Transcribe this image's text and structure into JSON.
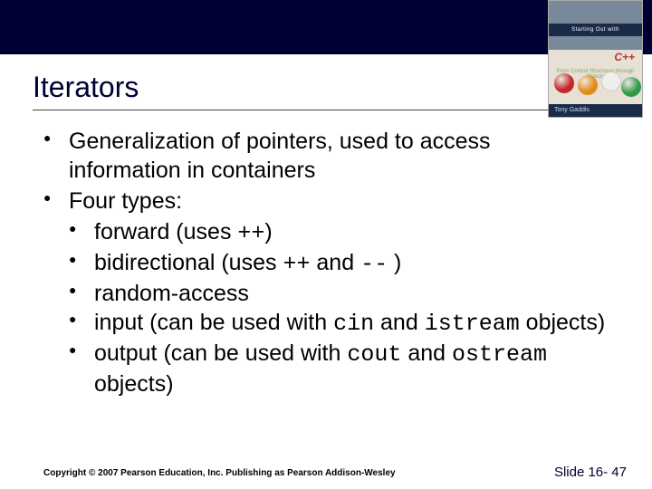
{
  "cover": {
    "stripe": "Starting Out with",
    "lang": "C++",
    "subtitle": "From Control Structures through Objects",
    "author": "Tony Gaddis"
  },
  "title": "Iterators",
  "bullets": {
    "b1": "Generalization of pointers, used to access information in containers",
    "b2": "Four types:",
    "sub": {
      "s1a": "forward  (uses ",
      "s1b": "++",
      "s1c": ")",
      "s2a": "bidirectional  (uses ",
      "s2b": "++",
      "s2c": " and ",
      "s2d": "--",
      "s2e": " )",
      "s3": "random-access",
      "s4a": "input  (can be used with ",
      "s4b": "cin",
      "s4c": " and ",
      "s4d": "istream",
      "s4e": " objects)",
      "s5a": "output  (can be used with ",
      "s5b": "cout",
      "s5c": " and ",
      "s5d": "ostream",
      "s5e": " objects)"
    }
  },
  "footer": {
    "copyright": "Copyright © 2007 Pearson Education, Inc. Publishing as Pearson Addison-Wesley",
    "slide": "Slide 16- 47"
  }
}
